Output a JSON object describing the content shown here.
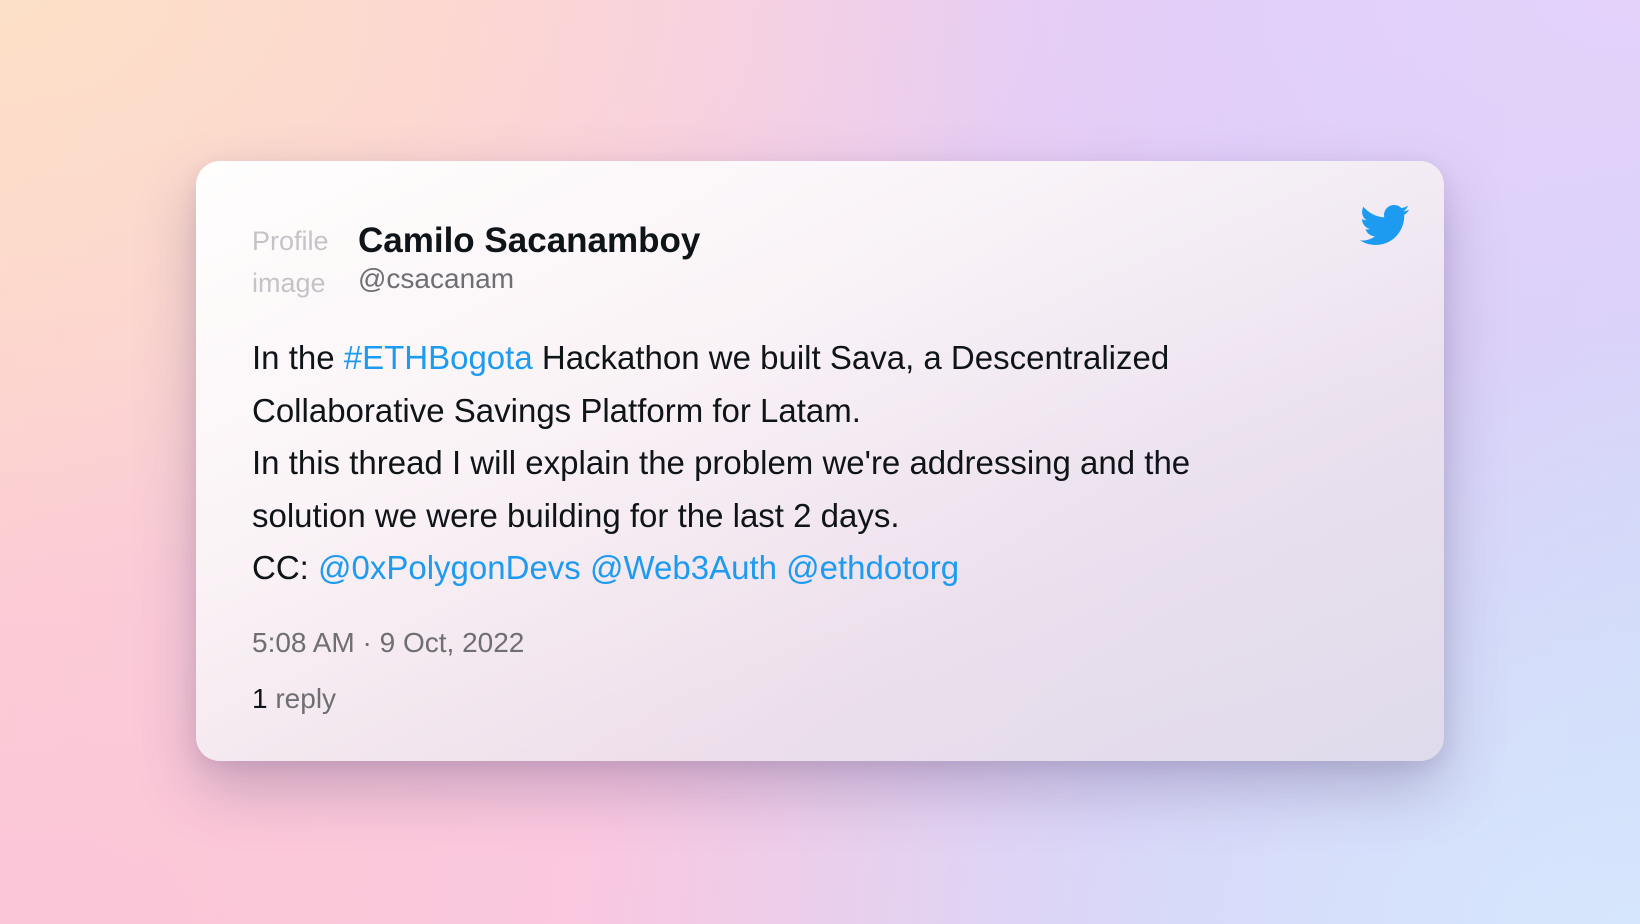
{
  "tweet": {
    "avatar_alt": "Profile image",
    "author_name": "Camilo Sacanamboy",
    "author_handle": "@csacanam",
    "body": {
      "line1_pre": "In the ",
      "hashtag": "#ETHBogota",
      "line1_post": " Hackathon we built Sava, a Descentralized",
      "line2": "Collaborative Savings Platform for Latam.",
      "line3": "In this thread I will explain the problem we're addressing and the",
      "line4": "solution we were building for the last 2 days.",
      "cc_label": "CC: ",
      "mention1": "@0xPolygonDevs",
      "mention2": "@Web3Auth",
      "mention3": "@ethdotorg"
    },
    "timestamp": "5:08 AM · 9 Oct, 2022",
    "reply_count": "1",
    "reply_label": " reply"
  },
  "icons": {
    "brand": "twitter-bird-icon"
  },
  "colors": {
    "link": "#1d9bf0",
    "brand": "#1d9bf0",
    "text": "#0f1419",
    "muted": "#6e6e73"
  }
}
